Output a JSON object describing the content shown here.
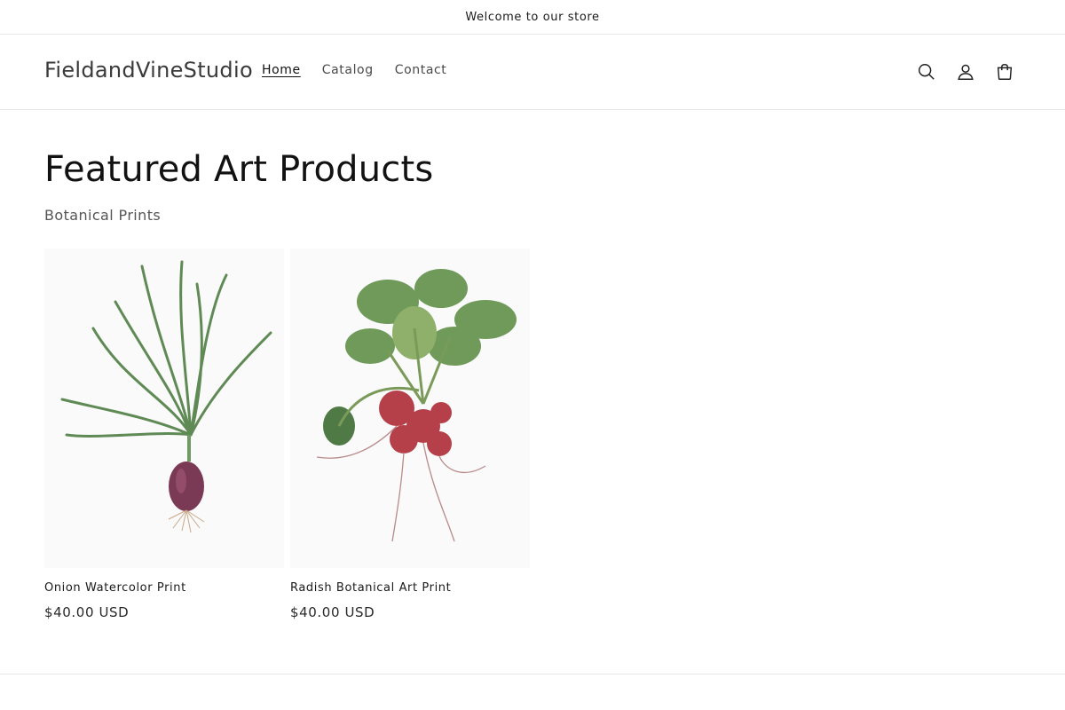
{
  "announcement": "Welcome to our store",
  "header": {
    "logo": "FieldandVineStudio",
    "nav": [
      {
        "label": "Home",
        "active": true
      },
      {
        "label": "Catalog",
        "active": false
      },
      {
        "label": "Contact",
        "active": false
      }
    ],
    "icons": [
      "search-icon",
      "account-icon",
      "cart-icon"
    ]
  },
  "main": {
    "title": "Featured Art Products",
    "subtitle": "Botanical Prints",
    "products": [
      {
        "title": "Onion Watercolor Print",
        "price": "$40.00 USD"
      },
      {
        "title": "Radish Botanical Art Print",
        "price": "$40.00 USD"
      }
    ]
  },
  "colors": {
    "text": "#121212",
    "border": "#e6e6e6",
    "radish": "#b5404a",
    "leaf": "#5f8a55",
    "onion": "#7a3a55"
  }
}
